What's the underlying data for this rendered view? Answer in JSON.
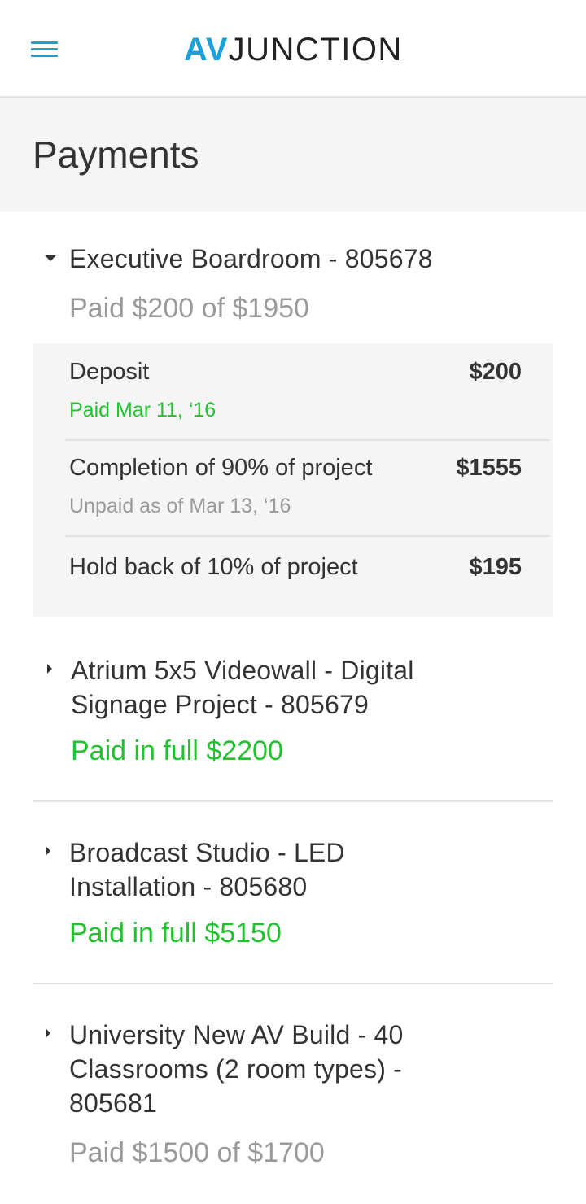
{
  "header": {
    "logo_av": "AV",
    "logo_junction": "JUNCTION",
    "menu_icon": "hamburger-menu-icon",
    "accent_color": "#1ba1d9"
  },
  "page": {
    "title": "Payments"
  },
  "projects": [
    {
      "expanded": true,
      "title": "Executive Boardroom - 805678",
      "status": "Paid $200 of $1950",
      "status_color": "#9a9a9a",
      "line_items": [
        {
          "label": "Deposit",
          "amount": "$200",
          "sub": "Paid Mar 11, ‘16",
          "sub_color": "#22c22e"
        },
        {
          "label": "Completion of 90% of project",
          "amount": "$1555",
          "sub": "Unpaid as of Mar 13, ‘16",
          "sub_color": "#9a9a9a"
        },
        {
          "label": "Hold back of 10% of project",
          "amount": "$195"
        }
      ]
    },
    {
      "expanded": false,
      "title_lines": [
        "Atrium 5x5 Videowall - Digital",
        "Signage Project - 805679"
      ],
      "status": "Paid in full $2200",
      "status_color": "#22c22e"
    },
    {
      "expanded": false,
      "title_lines": [
        "Broadcast Studio - LED",
        "Installation - 805680"
      ],
      "status": "Paid in full $5150",
      "status_color": "#22c22e"
    },
    {
      "expanded": false,
      "title_lines": [
        "University New AV Build - 40",
        "Classrooms (2 room types) -",
        "805681"
      ],
      "status": "Paid $1500 of $1700",
      "status_color": "#9a9a9a"
    }
  ]
}
